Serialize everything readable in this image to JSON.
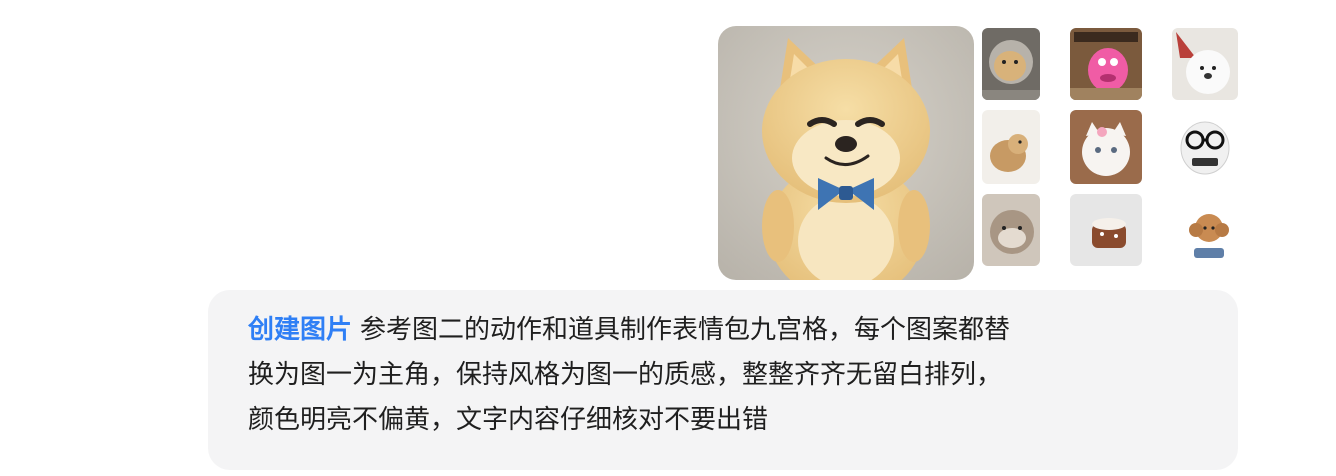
{
  "message": {
    "tag_label": "创建图片",
    "lines": [
      "参考图二的动作和道具制作表情包九宫格，每个图案都替",
      "换为图一为主角，保持风格为图一的质感，整整齐齐无留白排列，",
      "颜色明亮不偏黄，文字内容仔细核对不要出错"
    ]
  },
  "colors": {
    "accent": "#2f7ff5",
    "bubble_bg": "#f4f4f5"
  },
  "images": {
    "main": "shiba-plush-with-blue-bowtie",
    "grid": [
      "dog-meme-thumbnail",
      "pink-puppet-meme-thumbnail",
      "white-dog-meme-thumbnail",
      "small-dog-meme-thumbnail",
      "white-cat-meme-thumbnail",
      "dog-with-glasses-meme-thumbnail",
      "cat-meme-thumbnail",
      "cake-meme-thumbnail",
      "toy-poodle-meme-thumbnail"
    ]
  }
}
